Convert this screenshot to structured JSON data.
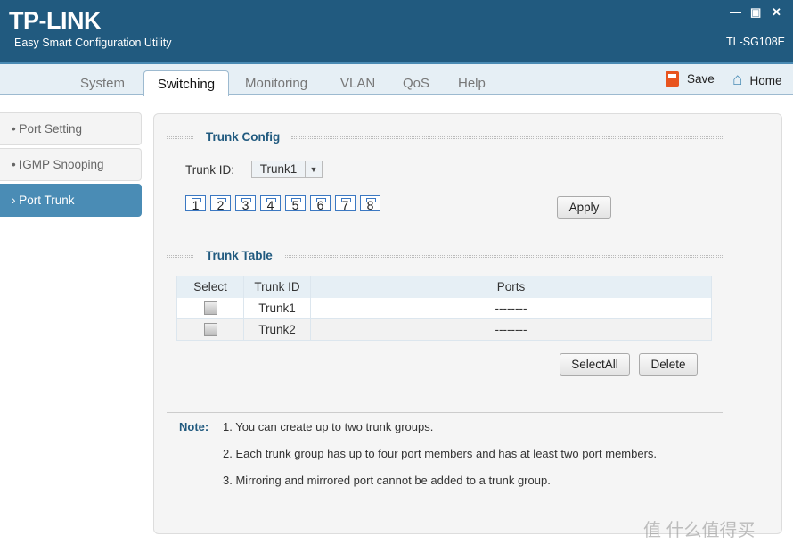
{
  "header": {
    "logo": "TP-LINK",
    "subtitle": "Easy Smart Configuration Utility",
    "model": "TL-SG108E",
    "minimize": "—",
    "maximize": "▣",
    "close": "✕"
  },
  "tabs": [
    {
      "label": "System"
    },
    {
      "label": "Switching",
      "selected": true
    },
    {
      "label": "Monitoring"
    },
    {
      "label": "VLAN"
    },
    {
      "label": "QoS"
    },
    {
      "label": "Help"
    }
  ],
  "toolbar": {
    "save": "Save",
    "home": "Home"
  },
  "sidebar": [
    {
      "label": "Port Setting"
    },
    {
      "label": "IGMP Snooping"
    },
    {
      "label": "Port Trunk",
      "selected": true
    }
  ],
  "trunk_config": {
    "title": "Trunk Config",
    "trunk_id_label": "Trunk ID:",
    "trunk_id_value": "Trunk1",
    "ports": [
      "1",
      "2",
      "3",
      "4",
      "5",
      "6",
      "7",
      "8"
    ],
    "apply": "Apply"
  },
  "trunk_table": {
    "title": "Trunk Table",
    "columns": [
      "Select",
      "Trunk ID",
      "Ports"
    ],
    "rows": [
      {
        "id": "Trunk1",
        "ports": "--------"
      },
      {
        "id": "Trunk2",
        "ports": "--------"
      }
    ],
    "select_all": "SelectAll",
    "delete": "Delete"
  },
  "note": {
    "label": "Note:",
    "items": [
      "1. You can create up to two trunk groups.",
      "2. Each trunk group has up to four port members and has at least two port members.",
      "3. Mirroring and mirrored port cannot be added to a trunk group."
    ]
  },
  "watermark": "值 什么值得买",
  "colors": {
    "header": "#215a7f",
    "accent": "#4a8cb5",
    "save_icon": "#e8541e",
    "home_icon": "#4a8cb5"
  }
}
